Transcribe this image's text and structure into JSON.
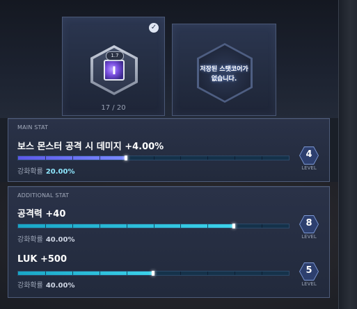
{
  "slots": {
    "equipped": {
      "level_badge": "1.7",
      "count": "17 / 20",
      "checked": true
    },
    "empty": {
      "line1": "저장된 스탯코어가",
      "line2": "없습니다."
    }
  },
  "main_stat": {
    "title": "MAIN STAT",
    "name": "보스 몬스터 공격 시 데미지 +4.00%",
    "progress": 0.4,
    "rate_label": "강화확률",
    "rate_value": "20.00%",
    "level": "4",
    "level_label": "LEVEL"
  },
  "additional_stat": {
    "title": "ADDITIONAL STAT",
    "stats": [
      {
        "name": "공격력 +40",
        "progress": 0.8,
        "rate_label": "강화확률",
        "rate_value": "40.00%",
        "level": "8",
        "level_label": "LEVEL"
      },
      {
        "name": "LUK +500",
        "progress": 0.5,
        "rate_label": "강화확률",
        "rate_value": "40.00%",
        "level": "5",
        "level_label": "LEVEL"
      }
    ]
  },
  "colors": {
    "main_bar": "#5c58e8",
    "add_bar": "#19a6c6",
    "rate_main": "#8fe8ff"
  }
}
